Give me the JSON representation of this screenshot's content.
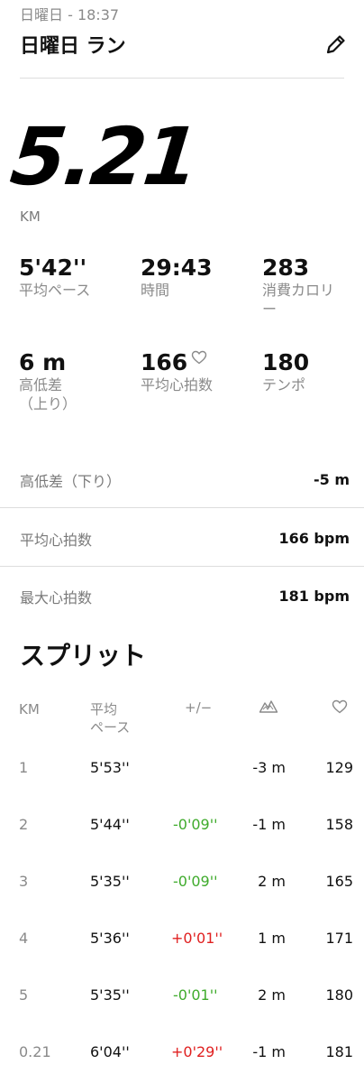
{
  "header": {
    "subtitle": "日曜日 - 18:37",
    "title": "日曜日 ラン",
    "edit_icon": "pencil-icon"
  },
  "summary": {
    "distance": "5.21",
    "distance_unit": "KM",
    "stats": [
      {
        "value": "5'42''",
        "label": "平均ペース"
      },
      {
        "value": "29:43",
        "label": "時間"
      },
      {
        "value": "283",
        "label": "消費カロリ",
        "label2": "ー"
      },
      {
        "value": "6 m",
        "label": "高低差",
        "label2": "（上り）"
      },
      {
        "value": "166",
        "label": "平均心拍数"
      },
      {
        "value": "180",
        "label": "テンポ"
      }
    ]
  },
  "details": [
    {
      "label": "高低差（下り）",
      "value": "-5 m"
    },
    {
      "label": "平均心拍数",
      "value": "166 bpm"
    },
    {
      "label": "最大心拍数",
      "value": "181 bpm"
    }
  ],
  "splits": {
    "title": "スプリット",
    "headers": {
      "km": "KM",
      "pace": "平均",
      "pace2": "ペース",
      "diff": "+/−"
    },
    "rows": [
      {
        "km": "1",
        "pace": "5'53''",
        "diff": "",
        "elev": "-3 m",
        "hr": "129"
      },
      {
        "km": "2",
        "pace": "5'44''",
        "diff": "-0'09''",
        "elev": "-1 m",
        "hr": "158"
      },
      {
        "km": "3",
        "pace": "5'35''",
        "diff": "-0'09''",
        "elev": "2 m",
        "hr": "165"
      },
      {
        "km": "4",
        "pace": "5'36''",
        "diff": "+0'01''",
        "elev": "1 m",
        "hr": "171"
      },
      {
        "km": "5",
        "pace": "5'35''",
        "diff": "-0'01''",
        "elev": "2 m",
        "hr": "180"
      },
      {
        "km": "0.21",
        "pace": "6'04''",
        "diff": "+0'29''",
        "elev": "-1 m",
        "hr": "181"
      }
    ]
  },
  "colors": {
    "positive_diff": "#e02020",
    "negative_diff": "#3fab2c"
  }
}
